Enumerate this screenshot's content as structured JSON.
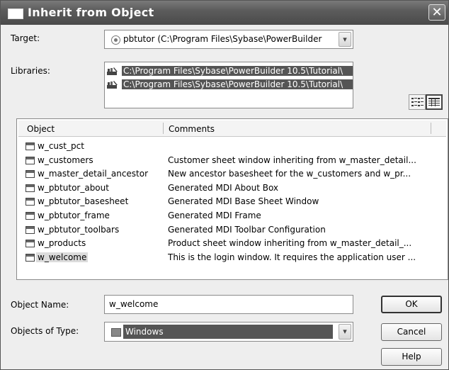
{
  "window": {
    "title": "Inherit from Object",
    "close_glyph": "✕"
  },
  "target": {
    "label": "Target:",
    "value": "pbtutor (C:\\Program Files\\Sybase\\PowerBuilder",
    "icon": "radio-target-icon"
  },
  "libraries": {
    "label": "Libraries:",
    "items": [
      "C:\\Program Files\\Sybase\\PowerBuilder 10.5\\Tutorial\\",
      "C:\\Program Files\\Sybase\\PowerBuilder 10.5\\Tutorial\\"
    ]
  },
  "view_buttons": [
    "list-view-icon",
    "details-view-icon"
  ],
  "object_list": {
    "columns": [
      "Object",
      "Comments"
    ],
    "rows": [
      {
        "name": "w_cust_pct",
        "comment": ""
      },
      {
        "name": "w_customers",
        "comment": "Customer sheet window inheriting from w_master_detail..."
      },
      {
        "name": "w_master_detail_ancestor",
        "comment": "New ancestor basesheet for the w_customers and w_pr..."
      },
      {
        "name": "w_pbtutor_about",
        "comment": "Generated MDI About Box"
      },
      {
        "name": "w_pbtutor_basesheet",
        "comment": "Generated MDI Base Sheet Window"
      },
      {
        "name": "w_pbtutor_frame",
        "comment": "Generated MDI Frame"
      },
      {
        "name": "w_pbtutor_toolbars",
        "comment": "Generated MDI Toolbar Configuration"
      },
      {
        "name": "w_products",
        "comment": "Product sheet window inheriting from w_master_detail_..."
      },
      {
        "name": "w_welcome",
        "comment": "This is the login window. It requires the application user ..."
      }
    ],
    "selected_index": 8
  },
  "object_name": {
    "label": "Object Name:",
    "value": "w_welcome"
  },
  "object_type": {
    "label": "Objects of Type:",
    "value": "Windows"
  },
  "buttons": {
    "ok": "OK",
    "cancel": "Cancel",
    "help": "Help"
  },
  "colors": {
    "titlebar": "#5c5c5c",
    "selection": "#555555",
    "background": "#eeeeee"
  }
}
